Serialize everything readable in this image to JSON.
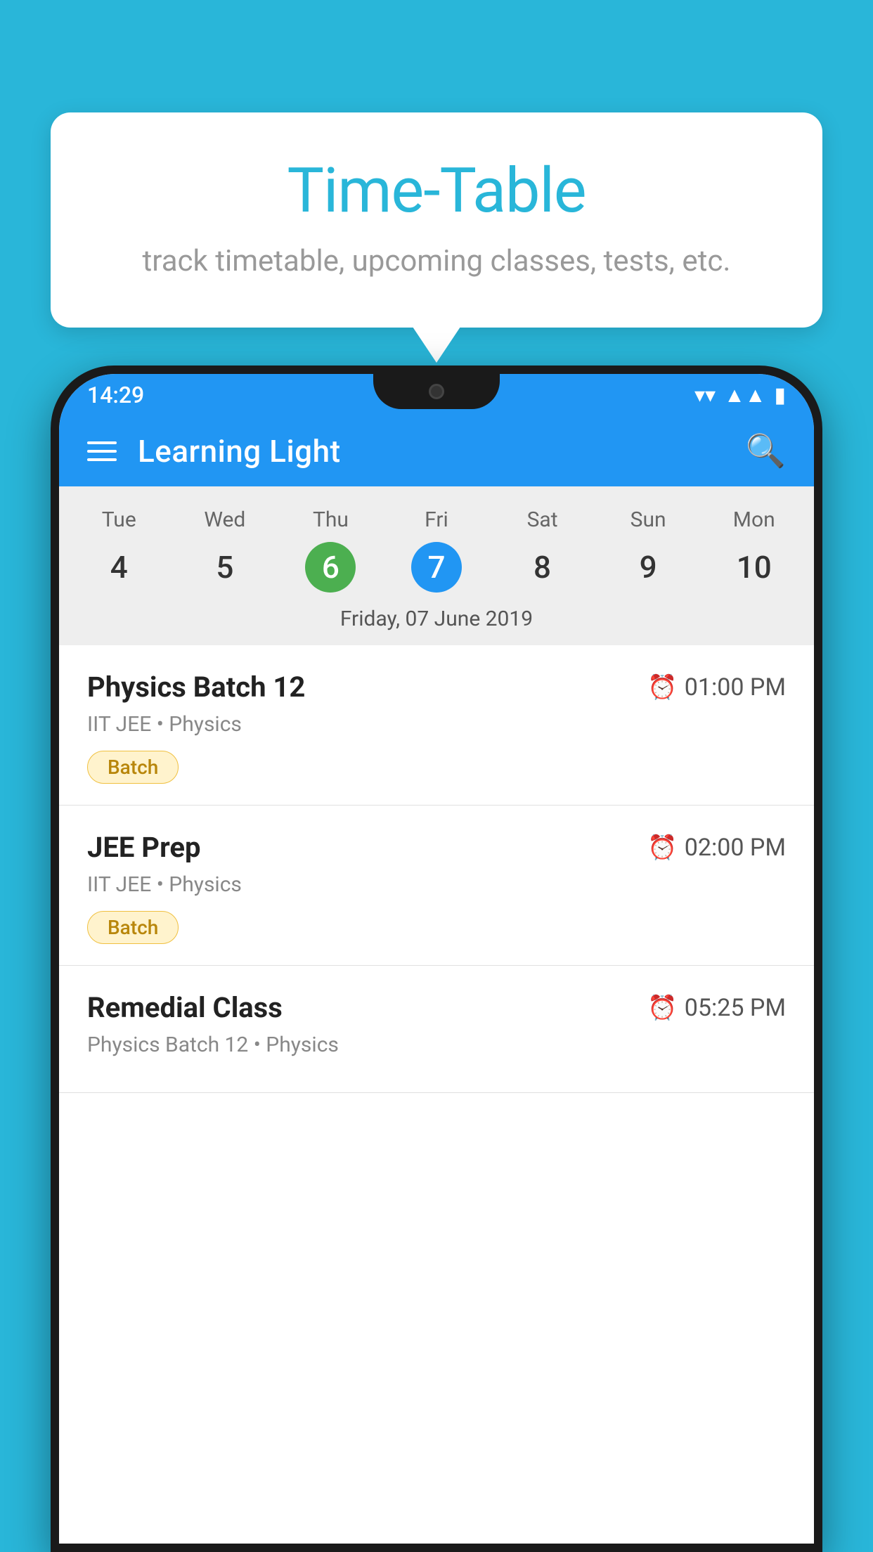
{
  "background_color": "#29b6d9",
  "bubble": {
    "title": "Time-Table",
    "subtitle": "track timetable, upcoming classes, tests, etc."
  },
  "phone": {
    "status_bar": {
      "time": "14:29"
    },
    "app_bar": {
      "title": "Learning Light"
    },
    "calendar": {
      "days": [
        {
          "label": "Tue",
          "num": "4"
        },
        {
          "label": "Wed",
          "num": "5"
        },
        {
          "label": "Thu",
          "num": "6",
          "state": "today"
        },
        {
          "label": "Fri",
          "num": "7",
          "state": "selected"
        },
        {
          "label": "Sat",
          "num": "8"
        },
        {
          "label": "Sun",
          "num": "9"
        },
        {
          "label": "Mon",
          "num": "10"
        }
      ],
      "selected_date": "Friday, 07 June 2019"
    },
    "classes": [
      {
        "name": "Physics Batch 12",
        "time": "01:00 PM",
        "meta": "IIT JEE • Physics",
        "badge": "Batch"
      },
      {
        "name": "JEE Prep",
        "time": "02:00 PM",
        "meta": "IIT JEE • Physics",
        "badge": "Batch"
      },
      {
        "name": "Remedial Class",
        "time": "05:25 PM",
        "meta": "Physics Batch 12 • Physics",
        "badge": null
      }
    ]
  }
}
